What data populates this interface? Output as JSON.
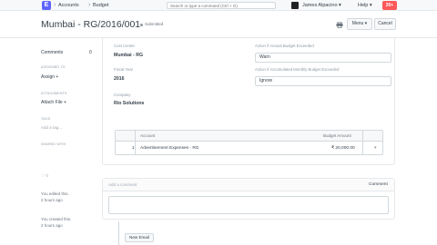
{
  "navbar": {
    "logo": "E",
    "breadcrumbs": [
      "Accounts",
      "Budget"
    ],
    "search_placeholder": "Search or type a command (Ctrl + G)",
    "user_name": "James Alpacino",
    "help_label": "Help",
    "notification_badge": "20+"
  },
  "page": {
    "title": "Mumbai - RG/2016/001",
    "status": "Submitted",
    "menu_button": "Menu",
    "cancel_button": "Cancel"
  },
  "sidebar": {
    "comments_label": "Comments",
    "comments_count": "0",
    "assigned_to_label": "ASSIGNED TO",
    "assign_link": "Assign +",
    "attachments_label": "ATTACHMENTS",
    "attach_link": "Attach File +",
    "tags_label": "TAGS",
    "add_tag": "Add a tag...",
    "shared_with_label": "SHARED WITH",
    "likes_count": "0",
    "activity": [
      {
        "text": "You edited this.",
        "time": "2 hours ago"
      },
      {
        "text": "You created this.",
        "time": "2 hours ago"
      }
    ]
  },
  "form": {
    "cost_center_label": "Cost Center",
    "cost_center_value": "Mumbai - RG",
    "fiscal_year_label": "Fiscal Year",
    "fiscal_year_value": "2016",
    "company_label": "Company",
    "company_value": "Rio Solutions",
    "annual_action_label": "Action if Annual Budget Exceeded",
    "annual_action_value": "Warn",
    "accumulated_action_label": "Action if Accumulated Monthly Budget Exceeded",
    "accumulated_action_value": "Ignore"
  },
  "accounts_table": {
    "headers": [
      "Account",
      "Budget Amount"
    ],
    "rows": [
      {
        "idx": "1",
        "account": "Advertisement Expenses - RG",
        "amount": "₹ 20,000.00"
      }
    ]
  },
  "comments": {
    "placeholder": "Add a comment",
    "button": "Comment"
  },
  "timeline": {
    "new_email_button": "New Email"
  }
}
